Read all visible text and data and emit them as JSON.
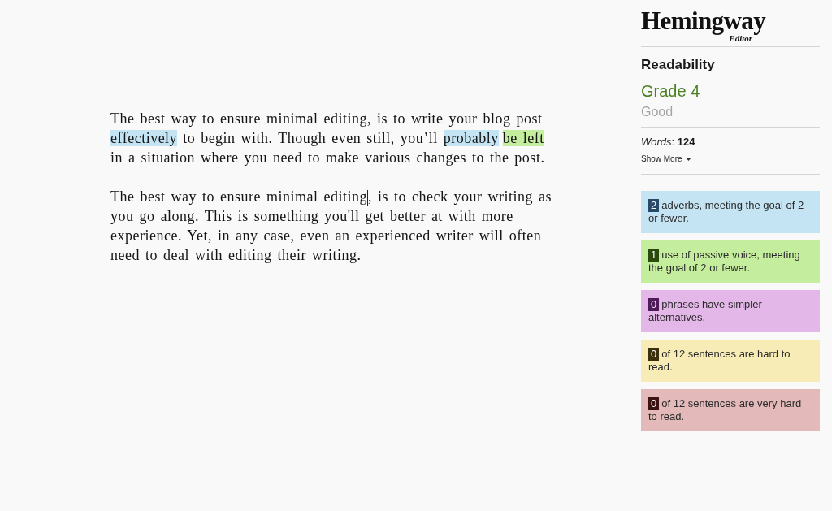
{
  "editor": {
    "paragraphs": [
      {
        "segments": [
          {
            "kind": "text",
            "text": "The best way to ensure minimal editing, is to write your blog post "
          },
          {
            "kind": "adverb",
            "text": "effectively"
          },
          {
            "kind": "text",
            "text": " to begin with. Though even still, you’ll "
          },
          {
            "kind": "adverb",
            "text": "probably"
          },
          {
            "kind": "passive",
            "text": "be left"
          },
          {
            "kind": "text",
            "text": " in a situation where you need to make various changes to the post."
          }
        ]
      },
      {
        "segments": [
          {
            "kind": "text",
            "text": "The best way to ensure minimal editing"
          },
          {
            "kind": "caret"
          },
          {
            "kind": "text",
            "text": ", is to check your writing as "
          },
          {
            "kind": "text",
            "text": "you go along. This is something you'll get better at with more "
          },
          {
            "kind": "text",
            "text": "experience. Yet, in any case, even an experienced writer will often "
          },
          {
            "kind": "text",
            "text": "need to deal with editing their writing."
          }
        ]
      }
    ]
  },
  "sidebar": {
    "logo": {
      "title": "Hemingway",
      "subtitle": "Editor"
    },
    "section_title": "Readability",
    "grade": "Grade 4",
    "grade_label": "Good",
    "word_count": "*Words*: **124**",
    "show_more": "Show More",
    "suggestions": [
      {
        "kind": "adverb",
        "count": "2",
        "text": "adverbs, meeting the goal of 2 or fewer."
      },
      {
        "kind": "passive",
        "count": "1",
        "text": "use of passive voice, meeting the goal of 2 or fewer."
      },
      {
        "kind": "simpler",
        "count": "0",
        "text": "phrases have simpler alternatives."
      },
      {
        "kind": "hard",
        "count": "0",
        "text": "of 12 sentences are hard to read."
      },
      {
        "kind": "very_hard",
        "count": "0",
        "text": "of 12 sentences are very hard to read."
      }
    ]
  }
}
